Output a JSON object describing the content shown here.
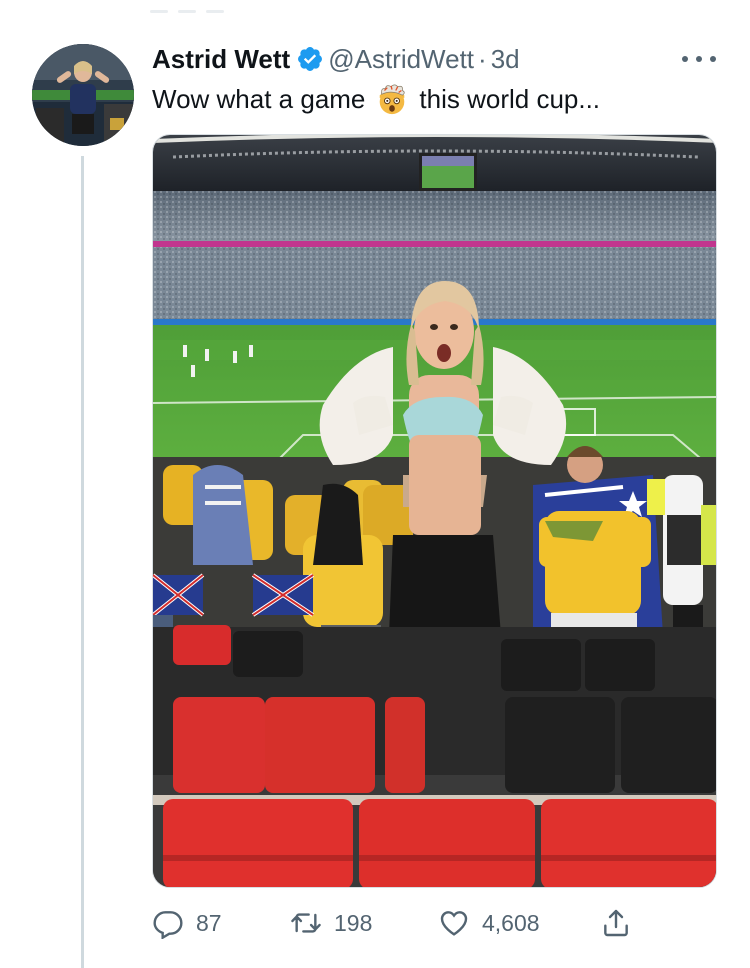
{
  "tweet": {
    "display_name": "Astrid Wett",
    "handle": "@AstridWett",
    "separator": "·",
    "timestamp": "3d",
    "text_before": "Wow what a game",
    "emoji_icon": "exploding-head-emoji",
    "text_after": "this world cup...",
    "verified": true
  },
  "actions": {
    "reply_count": "87",
    "retweet_count": "198",
    "like_count": "4,608"
  },
  "colors": {
    "verified_blue": "#1d9bf0",
    "secondary_text": "#536471",
    "thread_line": "#cfd9de"
  }
}
